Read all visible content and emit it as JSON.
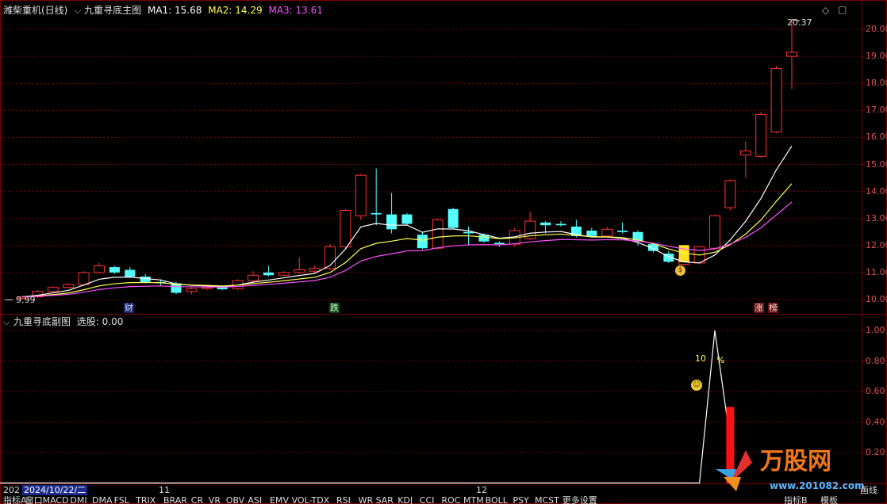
{
  "header": {
    "stock_name": "潍柴重机(日线)",
    "main_indicator": "九重寻底主图",
    "ma1_label": "MA1: 15.68",
    "ma2_label": "MA2: 14.29",
    "ma3_label": "MA3: 13.61"
  },
  "sub_header": {
    "indicator": "九重寻底副图",
    "value_label": "选股: 0.00"
  },
  "price_axis": [
    "20.00",
    "19.00",
    "18.00",
    "17.00",
    "16.00",
    "15.00",
    "14.00",
    "13.00",
    "12.00",
    "11.00",
    "10.00"
  ],
  "sub_axis": [
    "1.00",
    "0.80",
    "0.60",
    "0.40",
    "0.20"
  ],
  "annotations": {
    "high_price": "20.37",
    "low_price": "9.99",
    "sub_percent_value": "10",
    "sub_percent_sign": "%"
  },
  "markers": {
    "cai": "财",
    "die": "跌",
    "zhang": "涨",
    "bang": "榜"
  },
  "time_axis": {
    "left_year": "202",
    "selected_date": "2024/10/22/二",
    "month_11": "11",
    "month_12": "12"
  },
  "tabs": [
    "指标A",
    "窗口",
    "MACD",
    "DMI",
    "DMA",
    "FSL",
    "TRIX",
    "BRAR",
    "CR",
    "VR",
    "OBV",
    "ASI",
    "EMV",
    "VOL-TDX",
    "RSI",
    "WR",
    "SAR",
    "KDJ",
    "CCI",
    "ROC",
    "MTM",
    "BOLL",
    "PSY",
    "MCST",
    "更多",
    "设置"
  ],
  "right_tabs": [
    "指标B",
    "模板"
  ],
  "right_extra": "画线",
  "watermark": {
    "brand": "万股网",
    "url": "www.201082.com"
  },
  "colors": {
    "up": "#ff3232",
    "down": "#54ffff",
    "ma1": "#ffffff",
    "ma2": "#ffff50",
    "ma3": "#ff50ff",
    "grid": "#7a0000",
    "axis_text": "#e05050"
  },
  "chart_data": [
    {
      "type": "candlestick",
      "title": "九重寻底主图",
      "ylim": [
        9.7,
        20.6
      ],
      "ohlc": [
        [
          10.05,
          10.15,
          9.99,
          10.1
        ],
        [
          10.1,
          10.35,
          10.05,
          10.3
        ],
        [
          10.3,
          10.5,
          10.25,
          10.45
        ],
        [
          10.45,
          10.6,
          10.4,
          10.55
        ],
        [
          10.55,
          11.05,
          10.5,
          11.0
        ],
        [
          11.0,
          11.35,
          10.95,
          11.25
        ],
        [
          11.2,
          11.25,
          10.95,
          11.0
        ],
        [
          11.1,
          11.2,
          10.8,
          10.85
        ],
        [
          10.85,
          10.95,
          10.6,
          10.65
        ],
        [
          10.65,
          10.75,
          10.5,
          10.6
        ],
        [
          10.6,
          10.65,
          10.2,
          10.25
        ],
        [
          10.3,
          10.45,
          10.2,
          10.4
        ],
        [
          10.4,
          10.5,
          10.35,
          10.45
        ],
        [
          10.45,
          10.5,
          10.35,
          10.38
        ],
        [
          10.4,
          10.75,
          10.35,
          10.7
        ],
        [
          10.7,
          11.05,
          10.6,
          10.9
        ],
        [
          11.0,
          11.25,
          10.85,
          10.9
        ],
        [
          10.9,
          11.05,
          10.85,
          11.0
        ],
        [
          11.0,
          11.55,
          10.95,
          11.1
        ],
        [
          11.05,
          11.25,
          10.95,
          11.15
        ],
        [
          11.15,
          12.05,
          11.1,
          11.95
        ],
        [
          11.95,
          13.35,
          11.85,
          13.3
        ],
        [
          13.1,
          14.65,
          12.95,
          14.6
        ],
        [
          13.2,
          14.85,
          12.75,
          13.15
        ],
        [
          13.15,
          13.95,
          12.45,
          12.6
        ],
        [
          13.15,
          13.2,
          12.75,
          12.8
        ],
        [
          12.4,
          12.5,
          11.85,
          11.9
        ],
        [
          11.9,
          13.0,
          11.85,
          12.95
        ],
        [
          13.35,
          13.4,
          12.6,
          12.65
        ],
        [
          12.5,
          12.7,
          12.0,
          12.45
        ],
        [
          12.4,
          12.45,
          12.1,
          12.15
        ],
        [
          12.1,
          12.15,
          11.95,
          12.05
        ],
        [
          12.05,
          12.65,
          11.95,
          12.55
        ],
        [
          12.25,
          13.25,
          12.2,
          12.9
        ],
        [
          12.85,
          12.9,
          12.45,
          12.75
        ],
        [
          12.8,
          12.9,
          12.7,
          12.75
        ],
        [
          12.7,
          12.95,
          12.3,
          12.35
        ],
        [
          12.55,
          12.65,
          12.3,
          12.35
        ],
        [
          12.35,
          12.7,
          12.3,
          12.6
        ],
        [
          12.55,
          12.85,
          12.45,
          12.5
        ],
        [
          12.5,
          12.55,
          12.0,
          12.15
        ],
        [
          12.05,
          12.1,
          11.75,
          11.8
        ],
        [
          11.7,
          11.8,
          11.35,
          11.4
        ],
        [
          11.3,
          11.6,
          11.25,
          11.55
        ],
        [
          11.35,
          11.95,
          11.3,
          11.95
        ],
        [
          11.9,
          13.15,
          11.85,
          13.1
        ],
        [
          13.4,
          14.45,
          13.3,
          14.4
        ],
        [
          15.35,
          15.85,
          14.5,
          15.5
        ],
        [
          15.3,
          16.95,
          15.25,
          16.85
        ],
        [
          16.2,
          18.65,
          16.15,
          18.55
        ],
        [
          19.0,
          20.37,
          17.8,
          19.15
        ]
      ],
      "ma_labels": [
        "MA1",
        "MA2",
        "MA3"
      ],
      "ma_last": [
        15.68,
        14.29,
        13.61
      ]
    },
    {
      "type": "line",
      "title": "九重寻底副图",
      "ylim": [
        0,
        1.1
      ],
      "signal_line": [
        [
          44,
          0
        ],
        [
          45,
          1.0
        ],
        [
          46,
          0.28
        ]
      ],
      "bar": {
        "index": 46,
        "value": 0.5
      }
    }
  ]
}
